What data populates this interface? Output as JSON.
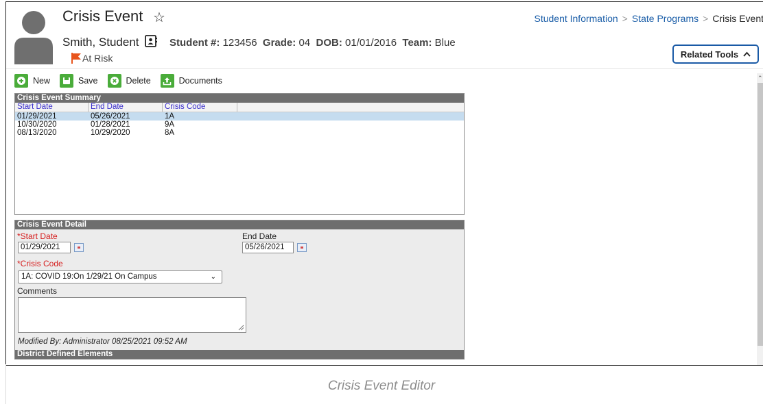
{
  "header": {
    "title": "Crisis Event",
    "student_name": "Smith, Student",
    "student_num_label": "Student #:",
    "student_num": "123456",
    "grade_label": "Grade:",
    "grade": "04",
    "dob_label": "DOB:",
    "dob": "01/01/2016",
    "team_label": "Team:",
    "team": "Blue",
    "flag_label": "At Risk",
    "flag_color": "#e8541c"
  },
  "breadcrumb": [
    "Student Information",
    "State Programs",
    "Crisis Event"
  ],
  "related_tools": "Related Tools",
  "toolbar": {
    "new": "New",
    "save": "Save",
    "delete": "Delete",
    "documents": "Documents",
    "icon_color": "#4aac3a"
  },
  "summary": {
    "title": "Crisis Event Summary",
    "columns": [
      "Start Date",
      "End Date",
      "Crisis Code"
    ],
    "rows": [
      [
        "01/29/2021",
        "05/26/2021",
        "1A"
      ],
      [
        "10/30/2020",
        "01/28/2021",
        "9A"
      ],
      [
        "08/13/2020",
        "10/29/2020",
        "8A"
      ]
    ]
  },
  "detail": {
    "title": "Crisis Event Detail",
    "start_date_label": "Start Date",
    "start_date": "01/29/2021",
    "end_date_label": "End Date",
    "end_date": "05/26/2021",
    "crisis_code_label": "Crisis Code",
    "crisis_code": "1A: COVID 19:On 1/29/21 On Campus",
    "comments_label": "Comments",
    "comments": "",
    "modified": "Modified By: Administrator 08/25/2021 09:52 AM",
    "district_label": "District Defined Elements"
  },
  "caption": "Crisis Event Editor"
}
